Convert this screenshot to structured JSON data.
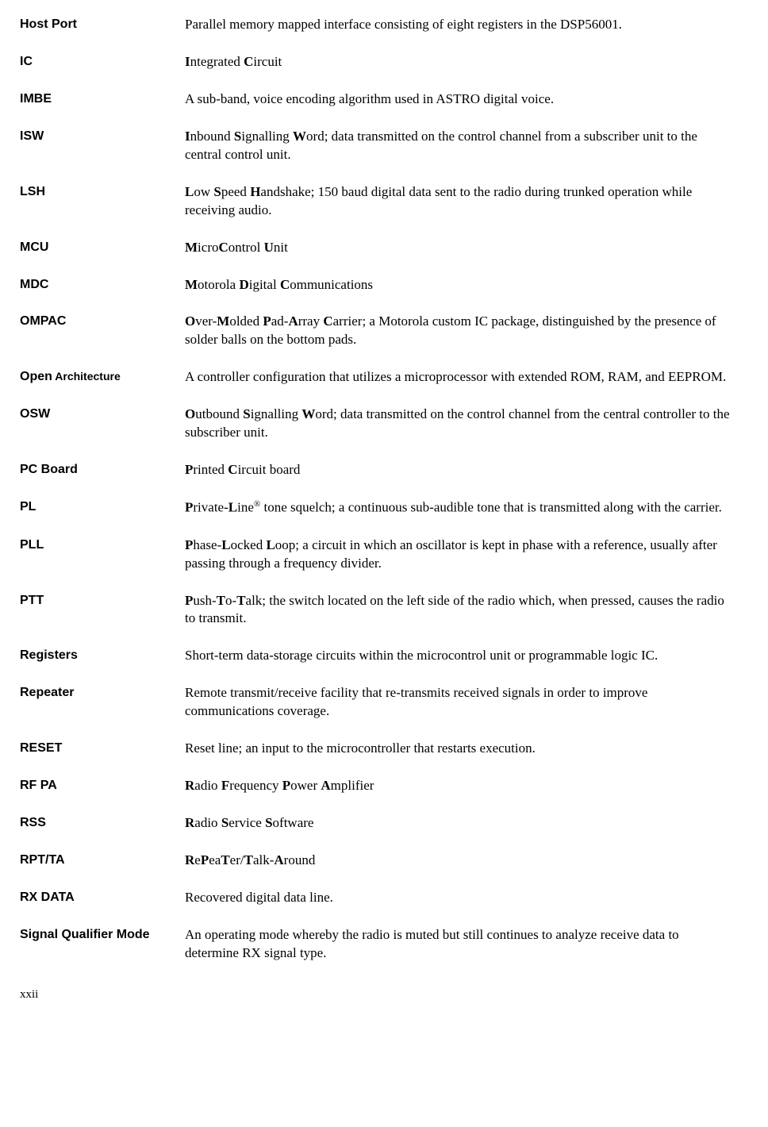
{
  "entries": [
    {
      "term": "Host Port",
      "def_parts": [
        {
          "t": "Parallel memory mapped interface consisting of eight registers in the DSP56001.",
          "b": false
        }
      ]
    },
    {
      "term": "IC",
      "def_parts": [
        {
          "t": "I",
          "b": true
        },
        {
          "t": "ntegrated ",
          "b": false
        },
        {
          "t": "C",
          "b": true
        },
        {
          "t": "ircuit",
          "b": false
        }
      ]
    },
    {
      "term": "IMBE",
      "def_parts": [
        {
          "t": "A sub-band, voice encoding algorithm used in ASTRO digital voice.",
          "b": false
        }
      ]
    },
    {
      "term": "ISW",
      "def_parts": [
        {
          "t": "I",
          "b": true
        },
        {
          "t": "nbound ",
          "b": false
        },
        {
          "t": "S",
          "b": true
        },
        {
          "t": "ignalling ",
          "b": false
        },
        {
          "t": "W",
          "b": true
        },
        {
          "t": "ord; data transmitted on the control channel from a subscriber unit to the central control unit.",
          "b": false
        }
      ]
    },
    {
      "term": "LSH",
      "def_parts": [
        {
          "t": "L",
          "b": true
        },
        {
          "t": "ow ",
          "b": false
        },
        {
          "t": "S",
          "b": true
        },
        {
          "t": "peed ",
          "b": false
        },
        {
          "t": "H",
          "b": true
        },
        {
          "t": "andshake; 150 baud digital data sent to the radio during trunked operation while receiving audio.",
          "b": false
        }
      ]
    },
    {
      "term": "MCU",
      "def_parts": [
        {
          "t": "M",
          "b": true
        },
        {
          "t": "icro",
          "b": false
        },
        {
          "t": "C",
          "b": true
        },
        {
          "t": "ontrol ",
          "b": false
        },
        {
          "t": "U",
          "b": true
        },
        {
          "t": "nit",
          "b": false
        }
      ]
    },
    {
      "term": "MDC",
      "def_parts": [
        {
          "t": "M",
          "b": true
        },
        {
          "t": "otorola ",
          "b": false
        },
        {
          "t": "D",
          "b": true
        },
        {
          "t": "igital ",
          "b": false
        },
        {
          "t": "C",
          "b": true
        },
        {
          "t": "ommunications",
          "b": false
        }
      ]
    },
    {
      "term": "OMPAC",
      "def_parts": [
        {
          "t": "O",
          "b": true
        },
        {
          "t": "ver-",
          "b": false
        },
        {
          "t": "M",
          "b": true
        },
        {
          "t": "olded ",
          "b": false
        },
        {
          "t": "P",
          "b": true
        },
        {
          "t": "ad-",
          "b": false
        },
        {
          "t": "A",
          "b": true
        },
        {
          "t": "rray ",
          "b": false
        },
        {
          "t": "C",
          "b": true
        },
        {
          "t": "arrier; a Motorola custom IC package, distinguished by the presence of solder balls on the bottom pads.",
          "b": false
        }
      ]
    },
    {
      "term": "Open",
      "term_sub": " Architecture",
      "def_parts": [
        {
          "t": "A controller configuration that utilizes a microprocessor with extended ROM, RAM, and EEPROM.",
          "b": false
        }
      ]
    },
    {
      "term": "OSW",
      "def_parts": [
        {
          "t": "O",
          "b": true
        },
        {
          "t": "utbound ",
          "b": false
        },
        {
          "t": "S",
          "b": true
        },
        {
          "t": "ignalling ",
          "b": false
        },
        {
          "t": "W",
          "b": true
        },
        {
          "t": "ord; data transmitted on the control channel from the central controller to the subscriber unit.",
          "b": false
        }
      ]
    },
    {
      "term": "PC Board",
      "def_parts": [
        {
          "t": "P",
          "b": true
        },
        {
          "t": "rinted ",
          "b": false
        },
        {
          "t": "C",
          "b": true
        },
        {
          "t": "ircuit board",
          "b": false
        }
      ]
    },
    {
      "term": "PL",
      "def_parts": [
        {
          "t": "P",
          "b": true
        },
        {
          "t": "rivate-",
          "b": false
        },
        {
          "t": "L",
          "b": true
        },
        {
          "t": "ine",
          "b": false
        },
        {
          "t": "®",
          "b": false,
          "sup": true
        },
        {
          "t": " tone squelch; a continuous sub-audible tone that is transmitted along with the carrier.",
          "b": false
        }
      ]
    },
    {
      "term": "PLL",
      "def_parts": [
        {
          "t": "P",
          "b": true
        },
        {
          "t": "hase-",
          "b": false
        },
        {
          "t": "L",
          "b": true
        },
        {
          "t": "ocked ",
          "b": false
        },
        {
          "t": "L",
          "b": true
        },
        {
          "t": "oop; a circuit in which an oscillator is kept in phase with a reference, usually after passing through a frequency divider.",
          "b": false
        }
      ]
    },
    {
      "term": "PTT",
      "def_parts": [
        {
          "t": "P",
          "b": true
        },
        {
          "t": "ush-",
          "b": false
        },
        {
          "t": "T",
          "b": true
        },
        {
          "t": "o-",
          "b": false
        },
        {
          "t": "T",
          "b": true
        },
        {
          "t": "alk; the switch located on the left side of the radio which, when pressed, causes the radio to transmit.",
          "b": false
        }
      ]
    },
    {
      "term": "Registers",
      "def_parts": [
        {
          "t": "Short-term data-storage circuits within the microcontrol unit or programmable logic IC.",
          "b": false
        }
      ]
    },
    {
      "term": "Repeater",
      "def_parts": [
        {
          "t": "Remote transmit/receive facility that re-transmits received signals in order to improve communications coverage.",
          "b": false
        }
      ]
    },
    {
      "term": "RESET",
      "def_parts": [
        {
          "t": "Reset line; an input to the microcontroller that restarts execution.",
          "b": false
        }
      ]
    },
    {
      "term": "RF PA",
      "def_parts": [
        {
          "t": "R",
          "b": true
        },
        {
          "t": "adio ",
          "b": false
        },
        {
          "t": "F",
          "b": true
        },
        {
          "t": "requency ",
          "b": false
        },
        {
          "t": "P",
          "b": true
        },
        {
          "t": "ower ",
          "b": false
        },
        {
          "t": "A",
          "b": true
        },
        {
          "t": "mplifier",
          "b": false
        }
      ]
    },
    {
      "term": "RSS",
      "def_parts": [
        {
          "t": "R",
          "b": true
        },
        {
          "t": "adio ",
          "b": false
        },
        {
          "t": "S",
          "b": true
        },
        {
          "t": "ervice ",
          "b": false
        },
        {
          "t": "S",
          "b": true
        },
        {
          "t": "oftware",
          "b": false
        }
      ]
    },
    {
      "term": "RPT/TA",
      "def_parts": [
        {
          "t": "R",
          "b": true
        },
        {
          "t": "e",
          "b": false
        },
        {
          "t": "P",
          "b": true
        },
        {
          "t": "ea",
          "b": false
        },
        {
          "t": "T",
          "b": true
        },
        {
          "t": "er/",
          "b": false
        },
        {
          "t": "T",
          "b": true
        },
        {
          "t": "alk-",
          "b": false
        },
        {
          "t": "A",
          "b": true
        },
        {
          "t": "round",
          "b": false
        }
      ]
    },
    {
      "term": "RX DATA",
      "def_parts": [
        {
          "t": "Recovered digital data line.",
          "b": false
        }
      ]
    },
    {
      "term": "Signal Qualifier Mode",
      "def_parts": [
        {
          "t": "An operating mode whereby the radio is muted but still continues to analyze receive data to determine RX signal type.",
          "b": false
        }
      ]
    }
  ],
  "page_number": "xxii"
}
